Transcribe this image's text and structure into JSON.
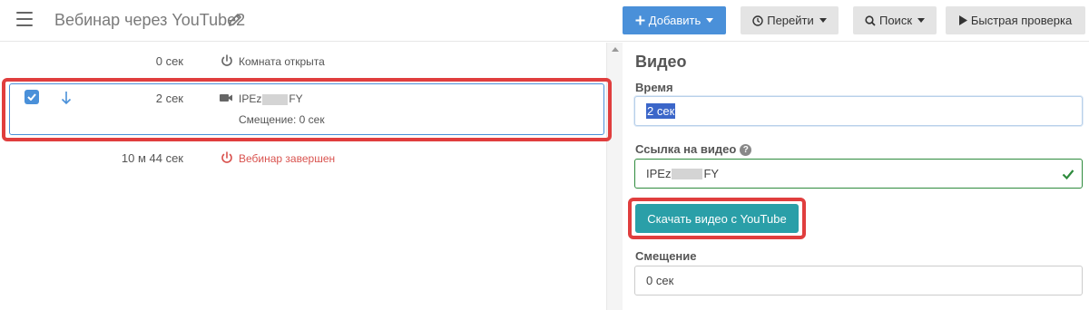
{
  "header": {
    "title": "Вебинар через YouTube2",
    "add_label": "Добавить",
    "go_label": "Перейти",
    "search_label": "Поиск",
    "quick_check_label": "Быстрая проверка"
  },
  "timeline": {
    "events": [
      {
        "time": "0 сек",
        "text": "Комната открыта",
        "icon": "power-icon"
      },
      {
        "time": "2 сек",
        "video_prefix": "IPEz",
        "video_suffix": "FY",
        "offset_text": "Смещение: 0 сек",
        "icon": "video-icon"
      },
      {
        "time": "10 м 44 сек",
        "text": "Вебинар завершен",
        "icon": "power-icon",
        "color": "#d9534f"
      }
    ]
  },
  "panel": {
    "title": "Видео",
    "time_label": "Время",
    "time_value": "2 сек",
    "url_label": "Ссылка на видео",
    "url_prefix": "IPEz",
    "url_suffix": "FY",
    "download_label": "Скачать видео с YouTube",
    "offset_label": "Смещение",
    "offset_value": "0 сек"
  },
  "colors": {
    "primary": "#4a90d9",
    "teal": "#2a9fa8",
    "danger": "#d9534f",
    "highlight": "#e03e3e"
  }
}
